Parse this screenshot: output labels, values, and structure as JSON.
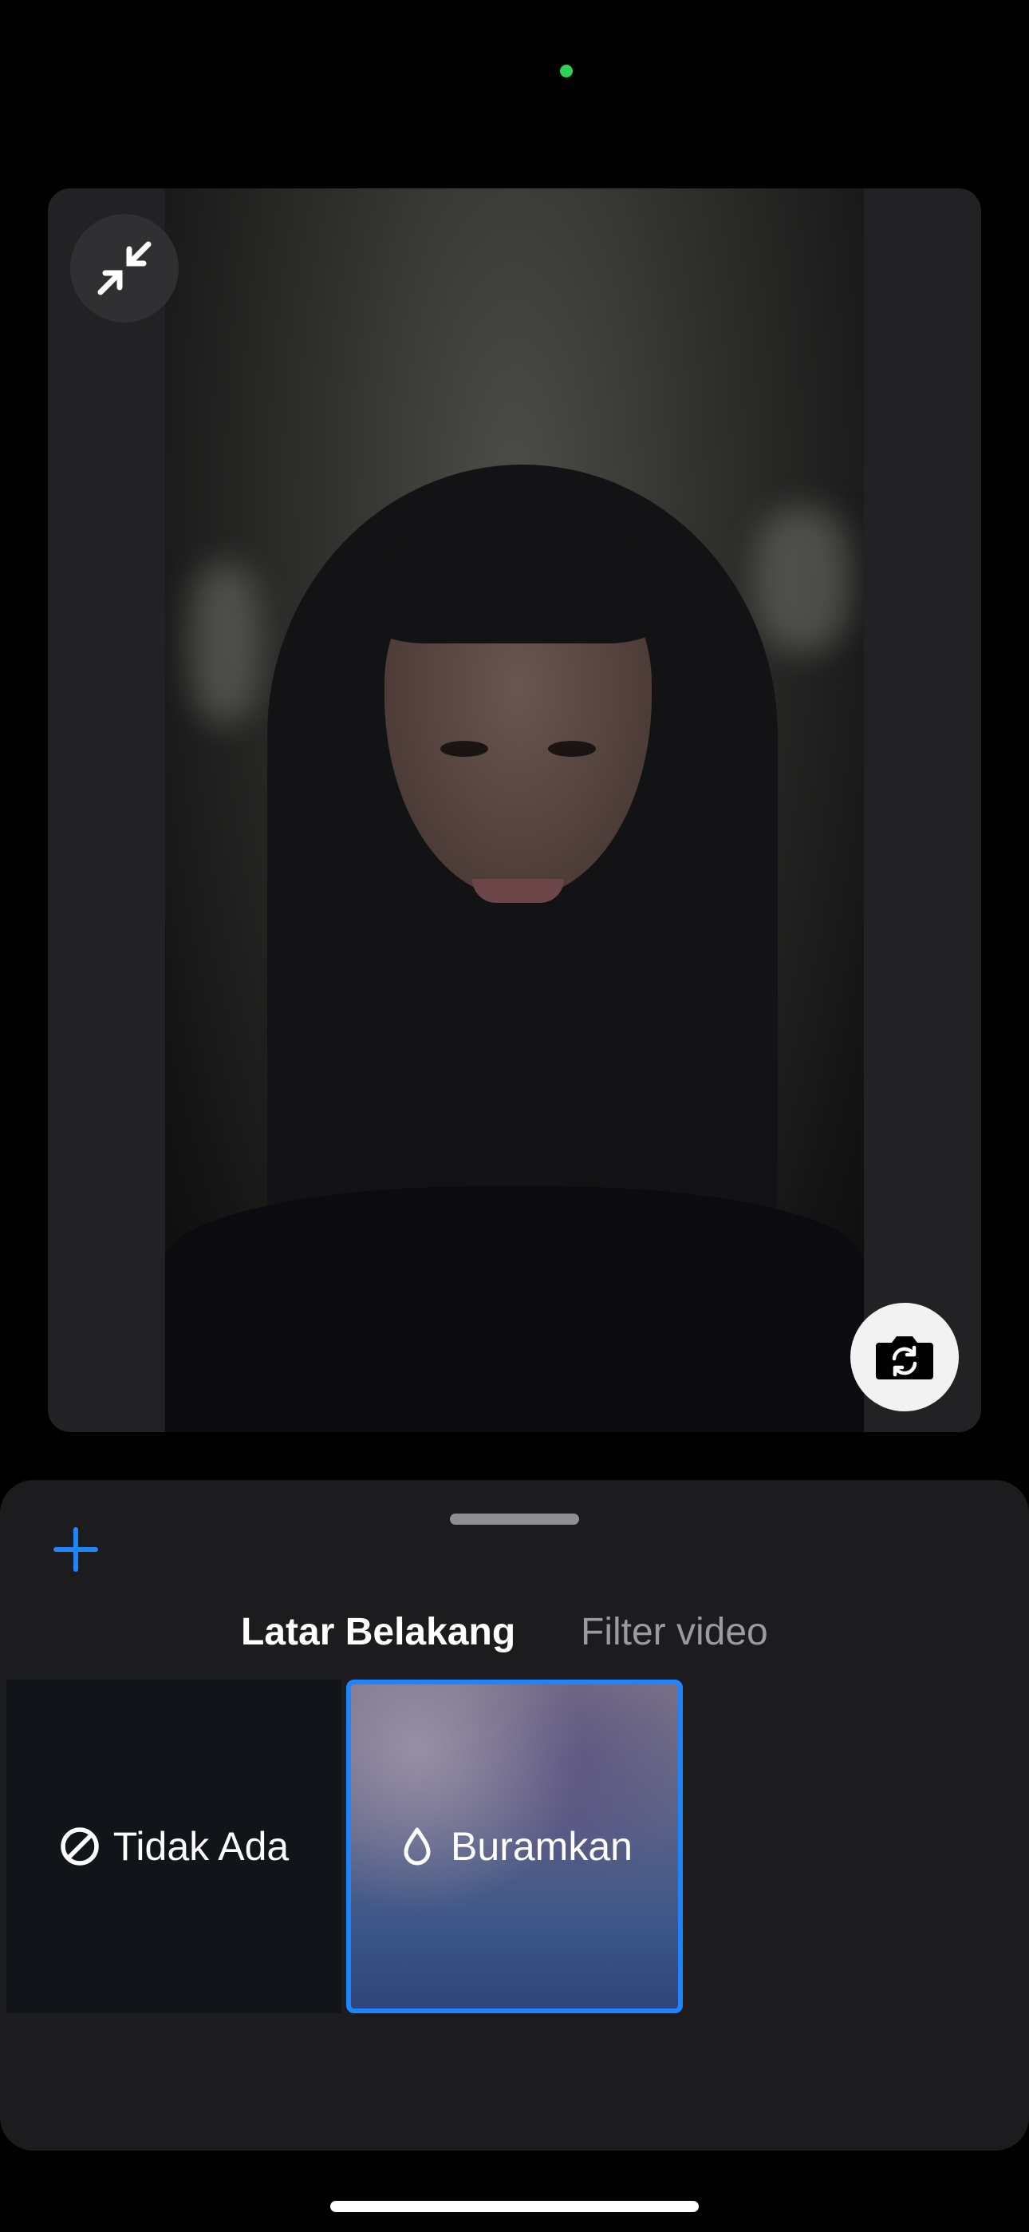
{
  "controls": {
    "collapse_icon": "collapse-arrows-icon",
    "flip_camera_icon": "camera-flip-icon"
  },
  "sheet": {
    "add_icon": "plus-icon",
    "tabs": [
      {
        "label": "Latar Belakang",
        "active": true
      },
      {
        "label": "Filter video",
        "active": false
      }
    ],
    "effects": [
      {
        "label": "Tidak Ada",
        "icon": "none-circle-icon",
        "selected": false
      },
      {
        "label": "Buramkan",
        "icon": "drop-icon",
        "selected": true
      }
    ]
  },
  "colors": {
    "accent": "#1f84ff",
    "status_dot": "#30d158",
    "sheet_background": "#1c1c1e",
    "inactive_tab": "#9a9a9f"
  }
}
